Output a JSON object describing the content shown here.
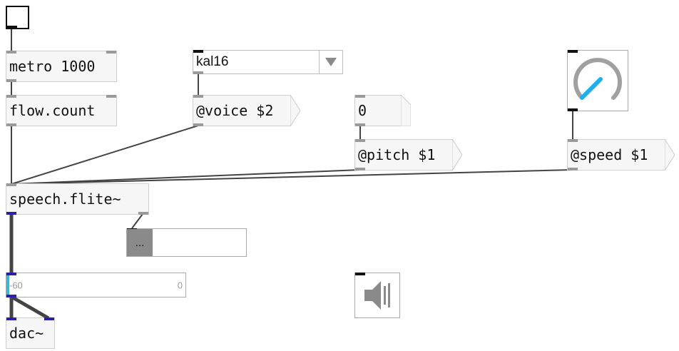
{
  "objects": {
    "metro": {
      "text": "metro 1000"
    },
    "flow_count": {
      "text": "flow.count"
    },
    "voice_menu": {
      "selected": "kal16"
    },
    "voice_msg": {
      "text": "@voice $2"
    },
    "number_msg": {
      "text": "0"
    },
    "pitch_msg": {
      "text": "@pitch $1"
    },
    "speed_msg": {
      "text": "@speed $1"
    },
    "speech": {
      "text": "speech.flite~"
    },
    "textedit": {
      "button": "..."
    },
    "meter": {
      "min": "-60",
      "max": "0"
    },
    "dac": {
      "text": "dac~"
    }
  },
  "icons": {
    "menu": "triangle-down-icon",
    "dial": "dial-icon",
    "ezdac": "speaker-icon"
  },
  "colors": {
    "cord": "#444444",
    "signal_port": "#2a1fa8",
    "dial_arc": "#a0a0a0",
    "dial_needle": "#1fb0ea",
    "meter_accent": "#3ab6d8"
  }
}
